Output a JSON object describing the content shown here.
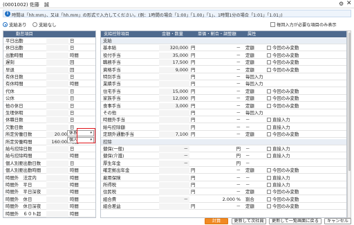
{
  "window": {
    "title": "(0001002) 佐藤　誠"
  },
  "info": {
    "text": "時間は「hh:mm」、又は「hh.mm」の形式で入力してください。(例：1時間の場合「1:00」「1.00」「1」、1時間1分の場合「1:01」「1.01」)"
  },
  "options": {
    "radio_with": "支給あり",
    "radio_without": "支給なし",
    "checkbox_label": "毎回入力が必要な項目のみ表示"
  },
  "left": {
    "header": "勤怠項目",
    "rows": [
      {
        "name": "平日出勤",
        "value": "",
        "unit": "日"
      },
      {
        "name": "休日出勤",
        "value": "",
        "unit": "日"
      },
      {
        "name": "出勤時間",
        "value": "",
        "unit": "時間"
      },
      {
        "name": "遅刻",
        "value": "",
        "unit": "回"
      },
      {
        "name": "早退",
        "value": "",
        "unit": "回"
      },
      {
        "name": "有休日数",
        "value": "",
        "unit": "日"
      },
      {
        "name": "有休時間",
        "value": "",
        "unit": "時間"
      },
      {
        "name": "代休",
        "value": "",
        "unit": "日"
      },
      {
        "name": "公休",
        "value": "",
        "unit": "日"
      },
      {
        "name": "他の休日",
        "value": "",
        "unit": "日"
      },
      {
        "name": "生理休暇",
        "value": "",
        "unit": "日"
      },
      {
        "name": "休職日数",
        "value": "",
        "unit": "日"
      },
      {
        "name": "欠勤日数",
        "value": "",
        "unit": "日"
      },
      {
        "name": "所定労働日数",
        "value": "20.00",
        "unit": "日"
      },
      {
        "name": "所定労働時間",
        "value": "160:00",
        "unit": "時間"
      },
      {
        "name": "給与控除日数",
        "value": "",
        "unit": "日"
      },
      {
        "name": "給与控除時間",
        "value": "",
        "unit": "時間"
      },
      {
        "name": "個人別要出勤日数",
        "value": "",
        "unit": "日"
      },
      {
        "name": "個人別要出勤時間",
        "value": "",
        "unit": "時間"
      },
      {
        "name": "時間外　法定内",
        "value": "",
        "unit": "時間"
      },
      {
        "name": "時間外　平日",
        "value": "",
        "unit": "時間"
      },
      {
        "name": "時間外　平日深夜",
        "value": "",
        "unit": "時間"
      },
      {
        "name": "時間外　休日",
        "value": "",
        "unit": "時間"
      },
      {
        "name": "時間外　休日深夜",
        "value": "",
        "unit": "時間"
      },
      {
        "name": "時間外　６０ｈ超",
        "value": "",
        "unit": "時間"
      }
    ],
    "dropdown1": "休系",
    "dropdown2": "個人"
  },
  "right": {
    "headers": {
      "item": "支給控除項目",
      "amount": "金額・数量",
      "rate": "単価・割合・調整額",
      "attr": "属性"
    },
    "rows": [
      {
        "type": "section",
        "name": "支給"
      },
      {
        "name": "基本給",
        "amount": "320,000",
        "unit": "円",
        "rate": "－",
        "attr": "定額",
        "cb": true,
        "note": "今回のみ変動"
      },
      {
        "name": "役付手当",
        "amount": "35,000",
        "unit": "円",
        "rate": "－",
        "attr": "定額",
        "cb": true,
        "note": "今回のみ変動"
      },
      {
        "name": "職務手当",
        "amount": "17,500",
        "unit": "円",
        "rate": "－",
        "attr": "定額",
        "cb": true,
        "note": "今回のみ変動"
      },
      {
        "name": "資格手当",
        "amount": "9,000",
        "unit": "円",
        "rate": "－",
        "attr": "定額",
        "cb": true,
        "note": "今回のみ変動"
      },
      {
        "name": "特別手当",
        "amount": "",
        "unit": "円",
        "rate": "－",
        "attr": "毎回入力",
        "cb": false,
        "note": ""
      },
      {
        "name": "業績手当",
        "amount": "",
        "unit": "円",
        "rate": "－",
        "attr": "毎回入力",
        "cb": false,
        "note": ""
      },
      {
        "name": "住宅手当",
        "amount": "15,000",
        "unit": "円",
        "rate": "－",
        "attr": "定額",
        "cb": true,
        "note": "今回のみ変動"
      },
      {
        "name": "家族手当",
        "amount": "12,000",
        "unit": "円",
        "rate": "－",
        "attr": "定額",
        "cb": true,
        "note": "今回のみ変動"
      },
      {
        "name": "食事手当",
        "amount": "3,000",
        "unit": "円",
        "rate": "－",
        "attr": "定額",
        "cb": true,
        "note": "今回のみ変動"
      },
      {
        "name": "その他",
        "amount": "",
        "unit": "円",
        "rate": "－",
        "attr": "毎回入力",
        "cb": false,
        "note": ""
      },
      {
        "name": "時間外手当",
        "amount": "",
        "unit": "円",
        "rate": "－",
        "attr": "－",
        "cb": true,
        "note": "直接入力"
      },
      {
        "name": "給与控除額",
        "amount": "",
        "unit": "円",
        "rate": "－",
        "attr": "－",
        "cb": true,
        "note": "直接入力"
      },
      {
        "name": "定期外通勤手当",
        "amount": "7,100",
        "unit": "円",
        "rate": "－",
        "attr": "定額",
        "cb": true,
        "note": "今回のみ変動"
      },
      {
        "type": "section",
        "name": "控除"
      },
      {
        "name": "健保(一般)",
        "amount": "－",
        "unit": "",
        "rate": "円",
        "attr": "－",
        "cb": true,
        "note": "直接入力"
      },
      {
        "name": "健保(介護)",
        "amount": "－",
        "unit": "",
        "rate": "円",
        "attr": "－",
        "cb": true,
        "note": "直接入力"
      },
      {
        "name": "厚生年金",
        "amount": "－",
        "unit": "",
        "rate": "円",
        "attr": "－",
        "cb": false,
        "note": ""
      },
      {
        "name": "確定拠出年金",
        "amount": "",
        "unit": "円",
        "rate": "－",
        "attr": "定額",
        "cb": true,
        "note": "今回のみ変動"
      },
      {
        "name": "雇用保険",
        "amount": "",
        "unit": "円",
        "rate": "－",
        "attr": "－",
        "cb": true,
        "note": "直接入力"
      },
      {
        "name": "所得税",
        "amount": "",
        "unit": "円",
        "rate": "－",
        "attr": "－",
        "cb": true,
        "note": "直接入力"
      },
      {
        "name": "住民税",
        "amount": "",
        "unit": "円",
        "rate": "－",
        "attr": "定額",
        "cb": true,
        "note": "今回のみ変動"
      },
      {
        "name": "組合費",
        "amount": "－",
        "unit": "",
        "rate": "2.000 %",
        "attr": "割合",
        "cb": true,
        "note": "今回のみ変動"
      },
      {
        "name": "組合差益",
        "amount": "",
        "unit": "円",
        "rate": "－",
        "attr": "定額",
        "cb": true,
        "note": "今回のみ変動"
      }
    ]
  },
  "footer": {
    "calc": "計算",
    "update_next": "更新して次社員",
    "update_back": "更新して一覧画面に戻る",
    "cancel": "キャンセル"
  }
}
